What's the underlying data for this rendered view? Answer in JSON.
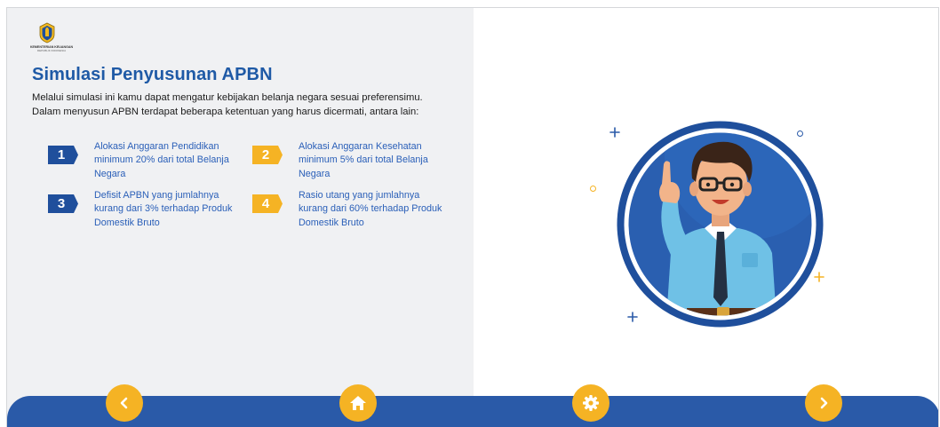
{
  "logo": {
    "name": "KEMENTERIAN KEUANGAN",
    "subtitle": "REPUBLIK INDONESIA"
  },
  "title": "Simulasi Penyusunan APBN",
  "intro": "Melalui simulasi ini kamu dapat mengatur kebijakan belanja negara sesuai preferensimu. Dalam menyusun APBN terdapat beberapa ketentuan yang harus dicermati, antara lain:",
  "rules": [
    {
      "number": "1",
      "text": "Alokasi Anggaran Pendidikan minimum 20% dari total Belanja Negara",
      "badge_color": "#1f4f9c"
    },
    {
      "number": "2",
      "text": "Alokasi Anggaran Kesehatan minimum 5% dari total Belanja Negara",
      "badge_color": "#f5b324"
    },
    {
      "number": "3",
      "text": "Defisit APBN yang jumlahnya kurang dari 3% terhadap Produk Domestik Bruto",
      "badge_color": "#1f4f9c"
    },
    {
      "number": "4",
      "text": "Rasio utang yang jumlahnya kurang dari 60% terhadap Produk Domestik Bruto",
      "badge_color": "#f5b324"
    }
  ],
  "nav": {
    "prev_icon": "chevron-left-icon",
    "home_icon": "home-icon",
    "settings_icon": "gear-icon",
    "next_icon": "chevron-right-icon"
  },
  "colors": {
    "primary": "#2a5aa8",
    "title": "#1f5aa6",
    "accent": "#f5b324",
    "panel_bg": "#f0f1f3"
  }
}
